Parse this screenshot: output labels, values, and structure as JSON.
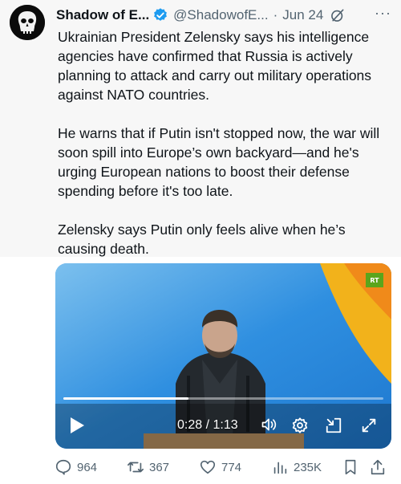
{
  "tweet": {
    "display_name": "Shadow of E...",
    "handle": "@ShadowofE...",
    "separator": "·",
    "date": "Jun 24",
    "more": "···",
    "paragraphs": [
      "Ukrainian President Zelensky says his intelligence agencies have confirmed that Russia is actively planning to attack and carry out military operations against NATO countries.",
      "He warns that if Putin isn't stopped now, the war will soon spill into Europe’s own backyard—and he's urging European nations to boost their defense spending before it's too late.",
      "Zelensky says Putin only feels alive when he’s causing death."
    ]
  },
  "video": {
    "badge": "RT",
    "time_label": "0:28 / 1:13",
    "progress_fraction": 0.39
  },
  "actions": {
    "replies": "964",
    "reposts": "367",
    "likes": "774",
    "views": "235K"
  },
  "colors": {
    "accent": "#1d9bf0",
    "muted": "#536471",
    "text": "#0f1419",
    "rt_green": "#5aa51c"
  },
  "icons": [
    "verified-badge-icon",
    "grok-icon",
    "more-icon",
    "play-icon",
    "volume-icon",
    "settings-icon",
    "dock-icon",
    "fullscreen-icon",
    "reply-icon",
    "repost-icon",
    "like-icon",
    "views-icon",
    "bookmark-icon",
    "share-icon"
  ]
}
